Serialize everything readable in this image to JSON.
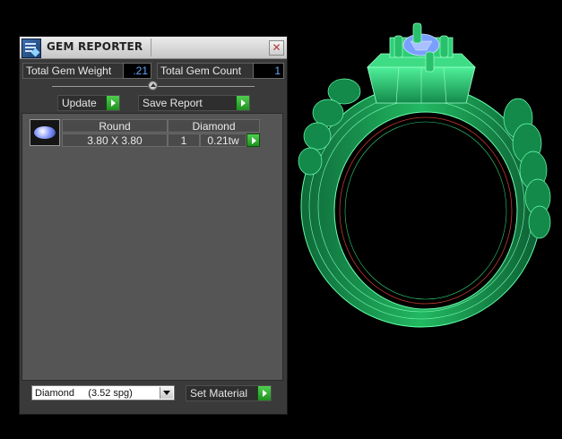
{
  "window": {
    "title": "GEM REPORTER",
    "close_glyph": "✕"
  },
  "totals": {
    "weight_label": "Total Gem Weight",
    "weight_value": ".21",
    "count_label": "Total Gem Count",
    "count_value": "1"
  },
  "actions": {
    "update_label": "Update",
    "save_label": "Save Report"
  },
  "gem_table": {
    "headers": [
      "Round",
      "Diamond"
    ],
    "rows": [
      {
        "size": "3.80 X 3.80",
        "qty": "1",
        "weight": "0.21tw"
      }
    ]
  },
  "material": {
    "selected": "Diamond     (3.52 spg)",
    "set_label": "Set Material"
  },
  "icons": {
    "app": "gem-reporter-icon",
    "close": "close-icon",
    "go": "green-arrow-icon",
    "slider": "slider-knob-icon",
    "dropdown": "chevron-down-icon",
    "gem": "round-gem-icon"
  },
  "colors": {
    "panel": "#3a3a3a",
    "value_text": "#5fa8ff",
    "go_button": "#2fb52f",
    "ring_wireframe": "#2ee07a",
    "gem_blue": "#7aa0ff"
  }
}
